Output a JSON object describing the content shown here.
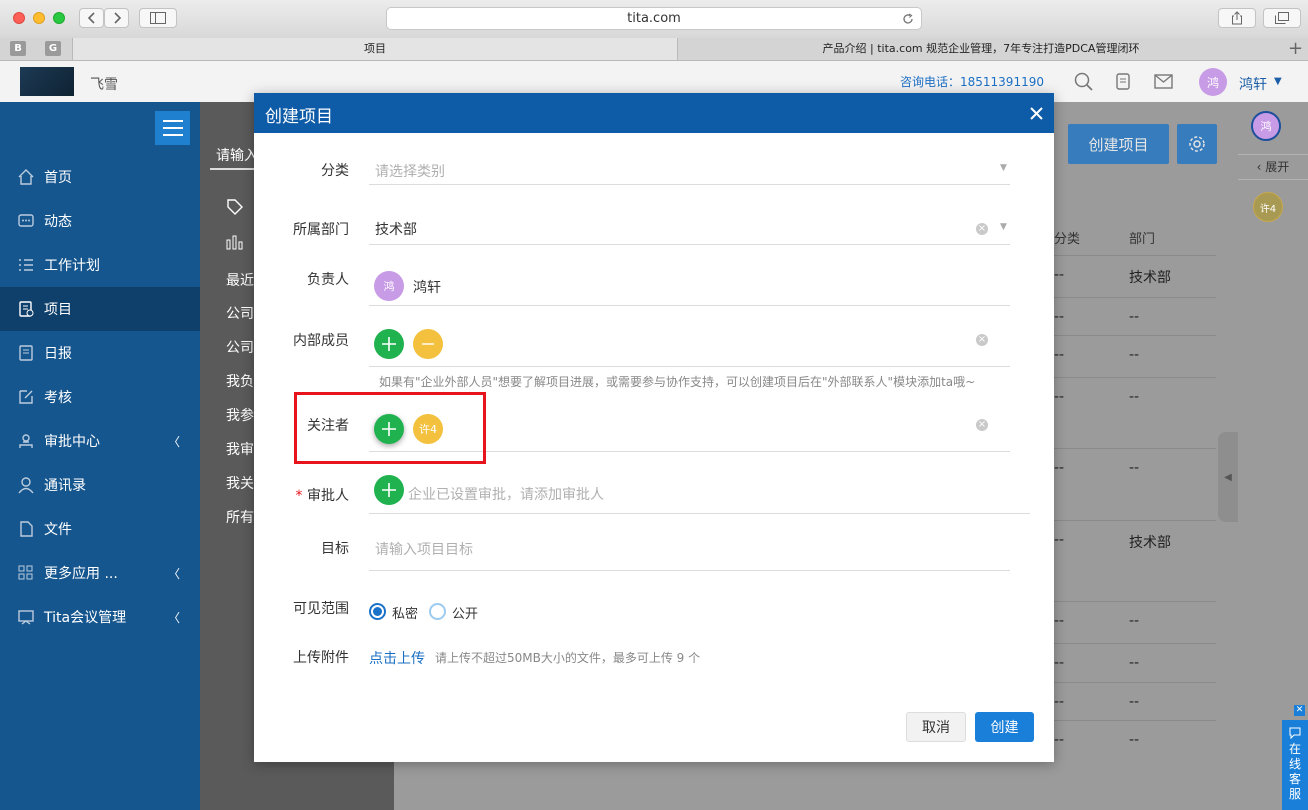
{
  "browser": {
    "url": "tita.com",
    "tabs": [
      {
        "label": "项目"
      },
      {
        "label": "产品介绍 | tita.com 规范企业管理，7年专注打造PDCA管理闭环"
      }
    ],
    "favicons": [
      "B",
      "G"
    ]
  },
  "header": {
    "company": "飞雪",
    "phone": "咨询电话：18511391190",
    "user_initial": "鸿",
    "user_name": "鸿轩"
  },
  "sidebar": {
    "items": [
      {
        "label": "首页",
        "icon": "home-icon"
      },
      {
        "label": "动态",
        "icon": "chat-icon"
      },
      {
        "label": "工作计划",
        "icon": "list-icon"
      },
      {
        "label": "项目",
        "icon": "project-icon",
        "active": true
      },
      {
        "label": "日报",
        "icon": "report-icon"
      },
      {
        "label": "考核",
        "icon": "assess-icon"
      },
      {
        "label": "审批中心",
        "icon": "approval-icon",
        "chevron": true
      },
      {
        "label": "通讯录",
        "icon": "contacts-icon"
      },
      {
        "label": "文件",
        "icon": "file-icon"
      },
      {
        "label": "更多应用 ...",
        "icon": "apps-icon",
        "chevron": true
      },
      {
        "label": "Tita会议管理",
        "icon": "meeting-icon",
        "chevron": true
      }
    ]
  },
  "subpanel": {
    "search_placeholder": "请输入",
    "items": [
      "最近",
      "公司",
      "公司",
      "我负",
      "我参",
      "我审",
      "我关",
      "所有"
    ]
  },
  "main": {
    "create_button": "创建项目",
    "col_category": "分类",
    "col_dept": "部门",
    "rows": [
      {
        "cat": "--",
        "dept": "技术部"
      },
      {
        "cat": "--",
        "dept": "--"
      },
      {
        "cat": "--",
        "dept": "--"
      },
      {
        "cat": "--",
        "dept": "--"
      },
      {
        "cat": "--",
        "dept": "--"
      },
      {
        "cat": "--",
        "dept": "技术部"
      },
      {
        "cat": "--",
        "dept": "--"
      },
      {
        "cat": "--",
        "dept": "--"
      },
      {
        "cat": "--",
        "dept": "--"
      },
      {
        "cat": "--",
        "dept": "--"
      }
    ]
  },
  "rightbar": {
    "avatar": "鸿",
    "expand_label": "展开",
    "follower_avatar": "许4"
  },
  "chat_widget": {
    "label": "在线客服"
  },
  "modal": {
    "title": "创建项目",
    "category": {
      "label": "分类",
      "placeholder": "请选择类别"
    },
    "department": {
      "label": "所属部门",
      "value": "技术部"
    },
    "owner": {
      "label": "负责人",
      "avatar": "鸿",
      "name": "鸿轩"
    },
    "members": {
      "label": "内部成员",
      "hint": "如果有\"企业外部人员\"想要了解项目进展，或需要参与协作支持，可以创建项目后在\"外部联系人\"模块添加ta哦~"
    },
    "followers": {
      "label": "关注者",
      "avatar": "许4"
    },
    "approver": {
      "label": "审批人",
      "required": "*",
      "placeholder": "企业已设置审批，请添加审批人"
    },
    "goal": {
      "label": "目标",
      "placeholder": "请输入项目目标"
    },
    "visibility": {
      "label": "可见范围",
      "options": [
        "私密",
        "公开"
      ],
      "selected": "私密"
    },
    "attachment": {
      "label": "上传附件",
      "link": "点击上传",
      "hint": "请上传不超过50MB大小的文件，最多可上传 9 个"
    },
    "cancel": "取消",
    "create": "创建"
  },
  "colors": {
    "sidebar": "#16568f",
    "modal_header": "#0e5ba7",
    "green": "#20b24f",
    "highlight": "#e8141c",
    "avatar_purple": "#c89be6",
    "avatar_yellow": "#f3c13d"
  }
}
